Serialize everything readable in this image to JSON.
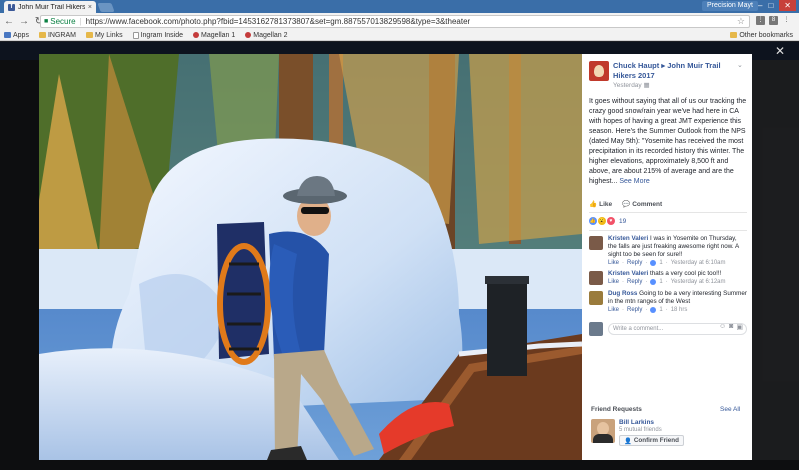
{
  "browser": {
    "tab_title": "John Muir Trail Hikers 20",
    "tab_close": "×",
    "profile": "Precision Mayt",
    "url_secure": "Secure",
    "url": "https://www.facebook.com/photo.php?fbid=1453162781373807&set=gm.887557013829598&type=3&theater",
    "bookmarks": [
      "Apps",
      "INGRAM",
      "My Links",
      "Ingram Inside",
      "Magellan 1",
      "Magellan 2"
    ],
    "other_bookmarks": "Other bookmarks",
    "extensions": [
      "⋮",
      "8",
      "⋮"
    ]
  },
  "post": {
    "author": "Chuck Haupt",
    "arrow": "▸",
    "group": "John Muir Trail Hikers 2017",
    "date": "Yesterday",
    "text": "It goes without saying that all of us our tracking the crazy good snow/rain year we've had here in CA with hopes of having a great JMT experience this season. Here's the Summer Outlook from the NPS (dated May 5th): \"Yosemite has received the most precipitation in its recorded history this winter. The higher elevations, approximately 8,500 ft and above, are about 215% of average and are the highest...",
    "see_more": "See More",
    "like_label": "Like",
    "comment_label": "Comment",
    "reaction_count": "19"
  },
  "comments": [
    {
      "name": "Kristen Valeri",
      "text": "I was in Yosemite on Thursday, the falls are just freaking awesome right now. A sight too be seen for sure!!",
      "like": "Like",
      "reply": "Reply",
      "likes": "1",
      "time": "Yesterday at 6:10am",
      "color": "#7a5a48"
    },
    {
      "name": "Kristen Valeri",
      "text": "thats a very cool pic too!!!",
      "like": "Like",
      "reply": "Reply",
      "likes": "1",
      "time": "Yesterday at 6:12am",
      "color": "#7a5a48"
    },
    {
      "name": "Dug Ross",
      "text": "Going to be a very interesting Summer in the mtn ranges of the West",
      "like": "Like",
      "reply": "Reply",
      "likes": "1",
      "time": "18 hrs",
      "color": "#9a7b3c"
    }
  ],
  "write_comment_placeholder": "Write a comment...",
  "friend_requests": {
    "title": "Friend Requests",
    "see_all": "See All",
    "name": "Bill Larkins",
    "mutual": "5 mutual friends",
    "button": "Confirm Friend"
  }
}
